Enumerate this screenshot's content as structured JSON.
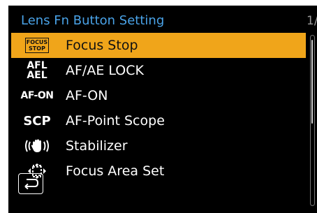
{
  "screen": {
    "title": "Lens Fn Button Setting",
    "page_indicator": "1/"
  },
  "menu": {
    "selected_index": 0,
    "items": [
      {
        "icon": "focus-stop-icon",
        "icon_lines": [
          "FOCUS",
          "STOP"
        ],
        "label": "Focus Stop"
      },
      {
        "icon": "af-ae-lock-icon",
        "icon_lines": [
          "AFL",
          "AEL"
        ],
        "label": "AF/AE LOCK"
      },
      {
        "icon": "af-on-icon",
        "icon_text": "AF-ON",
        "label": "AF-ON"
      },
      {
        "icon": "scp-icon",
        "icon_text": "SCP",
        "label": "AF-Point Scope"
      },
      {
        "icon": "stabilizer-hand-icon",
        "label": "Stabilizer"
      },
      {
        "icon": "focus-area-icon",
        "label": "Focus Area Set"
      }
    ]
  },
  "controls": {
    "back_icon": "return-arrow-icon"
  },
  "colors": {
    "title": "#4aa3e8",
    "selection": "#f0a51a",
    "background": "#000000",
    "text": "#ffffff"
  }
}
